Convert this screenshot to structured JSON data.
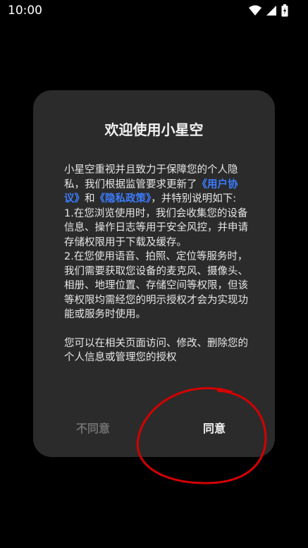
{
  "status_bar": {
    "time": "10:00",
    "icons": [
      "wifi-icon",
      "signal-icon",
      "battery-icon"
    ]
  },
  "dialog": {
    "title": "欢迎使用小星空",
    "intro_prefix": "小星空重视并且致力于保障您的个人隐私，我们根据监管要求更新了",
    "user_agreement_link": "《用户协议》",
    "and_text": "和",
    "privacy_policy_link": "《隐私政策》",
    "intro_suffix": "，并特别说明如下:",
    "item1": "1.在您浏览使用时，我们会收集您的设备信息、操作日志等用于安全风控，并申请存储权限用于下载及缓存。",
    "item2": "2.在您使用语音、拍照、定位等服务时，我们需要获取您设备的麦克风、摄像头、相册、地理位置、存储空间等权限，但该等权限均需经您的明示授权才会为实现功能或服务时使用。",
    "footer_text": "您可以在相关页面访问、修改、删除您的个人信息或管理您的授权",
    "disagree_label": "不同意",
    "agree_label": "同意"
  },
  "colors": {
    "background": "#000000",
    "dialog": "#2b2b2b",
    "link": "#3b7cff",
    "annotation_circle": "#d40000"
  }
}
